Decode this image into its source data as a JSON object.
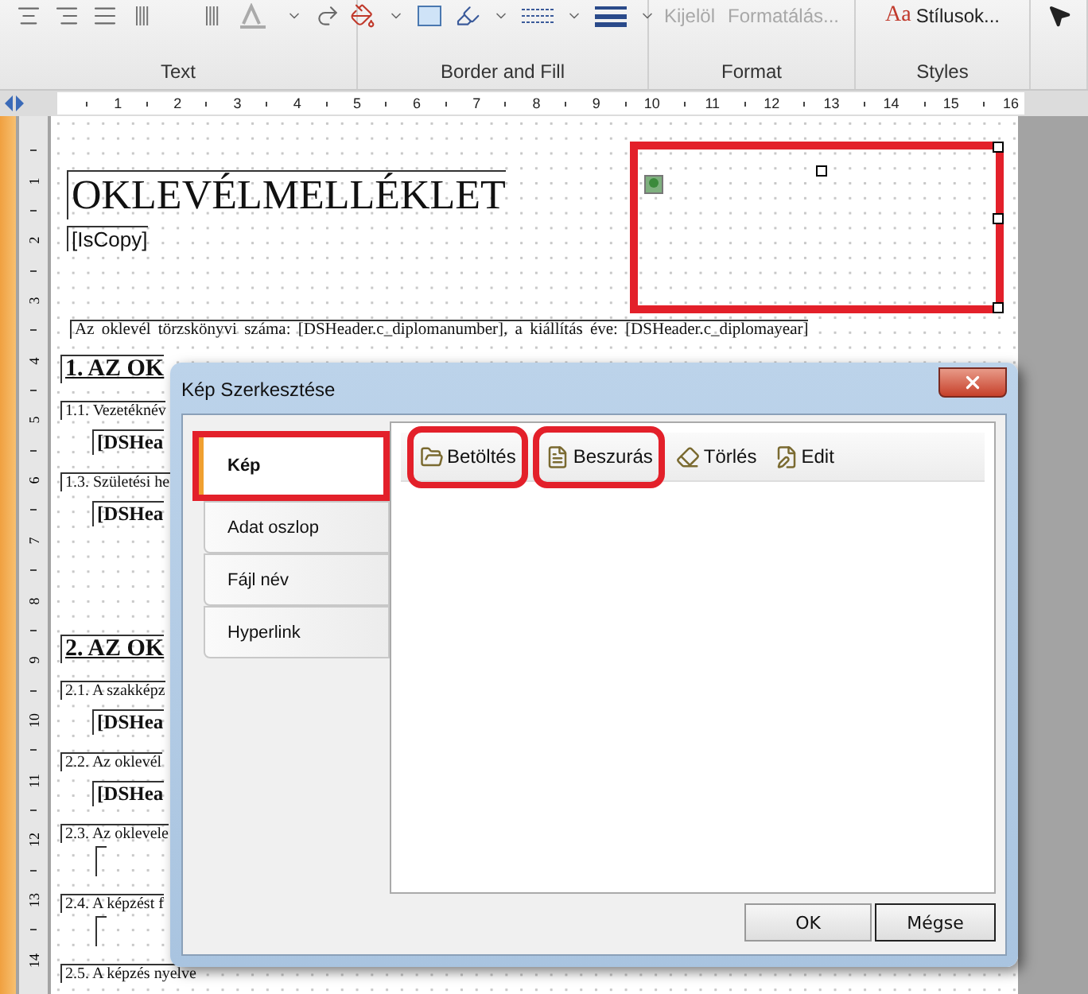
{
  "ribbon": {
    "groups": [
      {
        "kind": "text",
        "label": "Text"
      },
      {
        "kind": "border",
        "label": "Border and Fill"
      },
      {
        "kind": "format",
        "label": "Format",
        "buttons": [
          {
            "label": "Kijelöl",
            "disabled": true
          },
          {
            "label": "Formatálás...",
            "disabled": true
          }
        ]
      },
      {
        "kind": "styles",
        "label": "Styles",
        "buttons": [
          {
            "label": "Stílusok...",
            "glyph": "Aa",
            "disabled": false
          }
        ]
      },
      {
        "kind": "tools"
      }
    ]
  },
  "ruler": {
    "marks": [
      "1",
      "2",
      "3",
      "4",
      "5",
      "6",
      "7",
      "8",
      "9",
      "10",
      "11",
      "12",
      "13",
      "14",
      "15",
      "16"
    ]
  },
  "vertical_ruler": {
    "marks": [
      "1",
      "2",
      "3",
      "4",
      "5",
      "6",
      "7",
      "8",
      "9",
      "10",
      "11",
      "12",
      "13",
      "14"
    ]
  },
  "page": {
    "image_box": {
      "annotated": true
    },
    "lines": [
      {
        "kind": "title",
        "text": "OKLEVÉLMELLÉKLET"
      },
      {
        "kind": "copy",
        "text": "[IsCopy]"
      },
      {
        "kind": "paragraph",
        "text": "Az oklevél törzskönyvi száma: [DSHeader.c_diplomanumber], a kiállítás éve: [DSHeader.c_diplomayear]"
      },
      {
        "kind": "heading",
        "text": "1. AZ OK"
      },
      {
        "kind": "label",
        "text": "1.1. Vezetéknév"
      },
      {
        "kind": "field",
        "text": "[DSHea"
      },
      {
        "kind": "label",
        "text": "1.3. Születési he"
      },
      {
        "kind": "field",
        "text": "[DSHea"
      },
      {
        "kind": "heading",
        "text": "2. AZ OK"
      },
      {
        "kind": "label",
        "text": "2.1. A szakképz"
      },
      {
        "kind": "field",
        "text": "[DSHea"
      },
      {
        "kind": "label",
        "text": "2.2. Az oklevél"
      },
      {
        "kind": "field",
        "text": "[DSHea"
      },
      {
        "kind": "label",
        "text": "2.3. Az oklevele"
      },
      {
        "kind": "slot"
      },
      {
        "kind": "label",
        "text": "2.4. A képzést f"
      },
      {
        "kind": "slot"
      },
      {
        "kind": "label",
        "text": "2.5. A képzés nyelve"
      }
    ]
  },
  "dialog": {
    "title": "Kép Szerkesztése",
    "tabs": [
      {
        "label": "Kép",
        "selected": true,
        "annotated": true
      },
      {
        "label": "Adat oszlop",
        "selected": false,
        "annotated": false
      },
      {
        "label": "Fájl név",
        "selected": false,
        "annotated": false
      },
      {
        "label": "Hyperlink",
        "selected": false,
        "annotated": false
      }
    ],
    "toolbar": [
      {
        "kind": "load",
        "label": "Betöltés",
        "annotated": true
      },
      {
        "kind": "insert",
        "label": "Beszurás",
        "annotated": true
      },
      {
        "kind": "delete",
        "label": "Törlés",
        "annotated": false
      },
      {
        "kind": "edit",
        "label": "Edit",
        "annotated": false
      }
    ],
    "buttons": [
      {
        "label": "OK",
        "focused": false
      },
      {
        "label": "Mégse",
        "focused": true
      }
    ]
  }
}
